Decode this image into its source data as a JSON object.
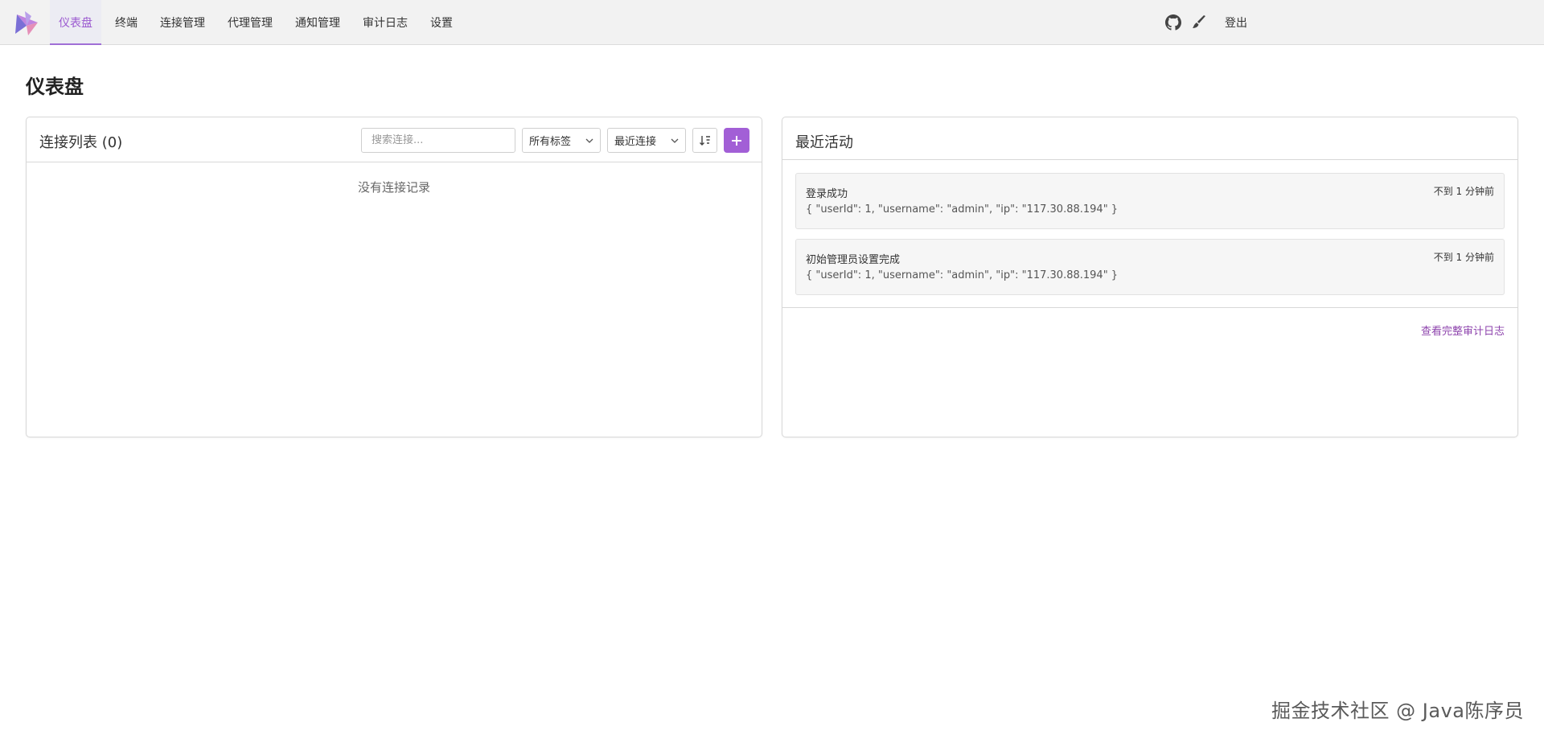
{
  "nav": {
    "items": [
      {
        "label": "仪表盘",
        "active": true
      },
      {
        "label": "终端"
      },
      {
        "label": "连接管理"
      },
      {
        "label": "代理管理"
      },
      {
        "label": "通知管理"
      },
      {
        "label": "审计日志"
      },
      {
        "label": "设置"
      }
    ],
    "logout": "登出",
    "accent": "#9b59d0"
  },
  "page": {
    "title": "仪表盘"
  },
  "connections": {
    "title": "连接列表 (0)",
    "search_placeholder": "搜索连接...",
    "tag_filter": "所有标签",
    "sort_by": "最近连接",
    "empty": "没有连接记录"
  },
  "activity": {
    "title": "最近活动",
    "items": [
      {
        "title": "登录成功",
        "detail": "{ \"userId\": 1, \"username\": \"admin\", \"ip\": \"117.30.88.194\" }",
        "time": "不到 1 分钟前"
      },
      {
        "title": "初始管理员设置完成",
        "detail": "{ \"userId\": 1, \"username\": \"admin\", \"ip\": \"117.30.88.194\" }",
        "time": "不到 1 分钟前"
      }
    ],
    "audit_link": "查看完整审计日志"
  },
  "watermark": "掘金技术社区 @ Java陈序员"
}
